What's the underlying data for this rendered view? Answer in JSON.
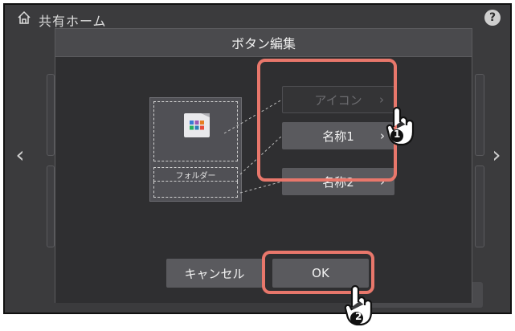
{
  "background": {
    "home_title": "共有ホーム",
    "help_label": "?",
    "nav_prev": "‹",
    "nav_next": "›"
  },
  "dialog": {
    "title": "ボタン編集",
    "preview": {
      "name_label": "フォルダー"
    },
    "options": [
      {
        "label": "アイコン",
        "chevron": "›",
        "enabled": false
      },
      {
        "label": "名称1",
        "chevron": "›",
        "enabled": true
      },
      {
        "label": "名称2",
        "chevron": "›",
        "enabled": true
      }
    ],
    "cancel_label": "キャンセル",
    "ok_label": "OK"
  },
  "callouts": {
    "step1": "1",
    "step2": "2"
  },
  "colors": {
    "highlight": "#e8776b",
    "screen_bg": "#3b3b3d",
    "dialog_bg": "#2f2f31",
    "button_bg": "#5a5a5e"
  },
  "icons": [
    "home-icon",
    "help-icon",
    "folder-icon",
    "chevron-right-icon",
    "chevron-left-icon",
    "pointer-hand-icon"
  ]
}
